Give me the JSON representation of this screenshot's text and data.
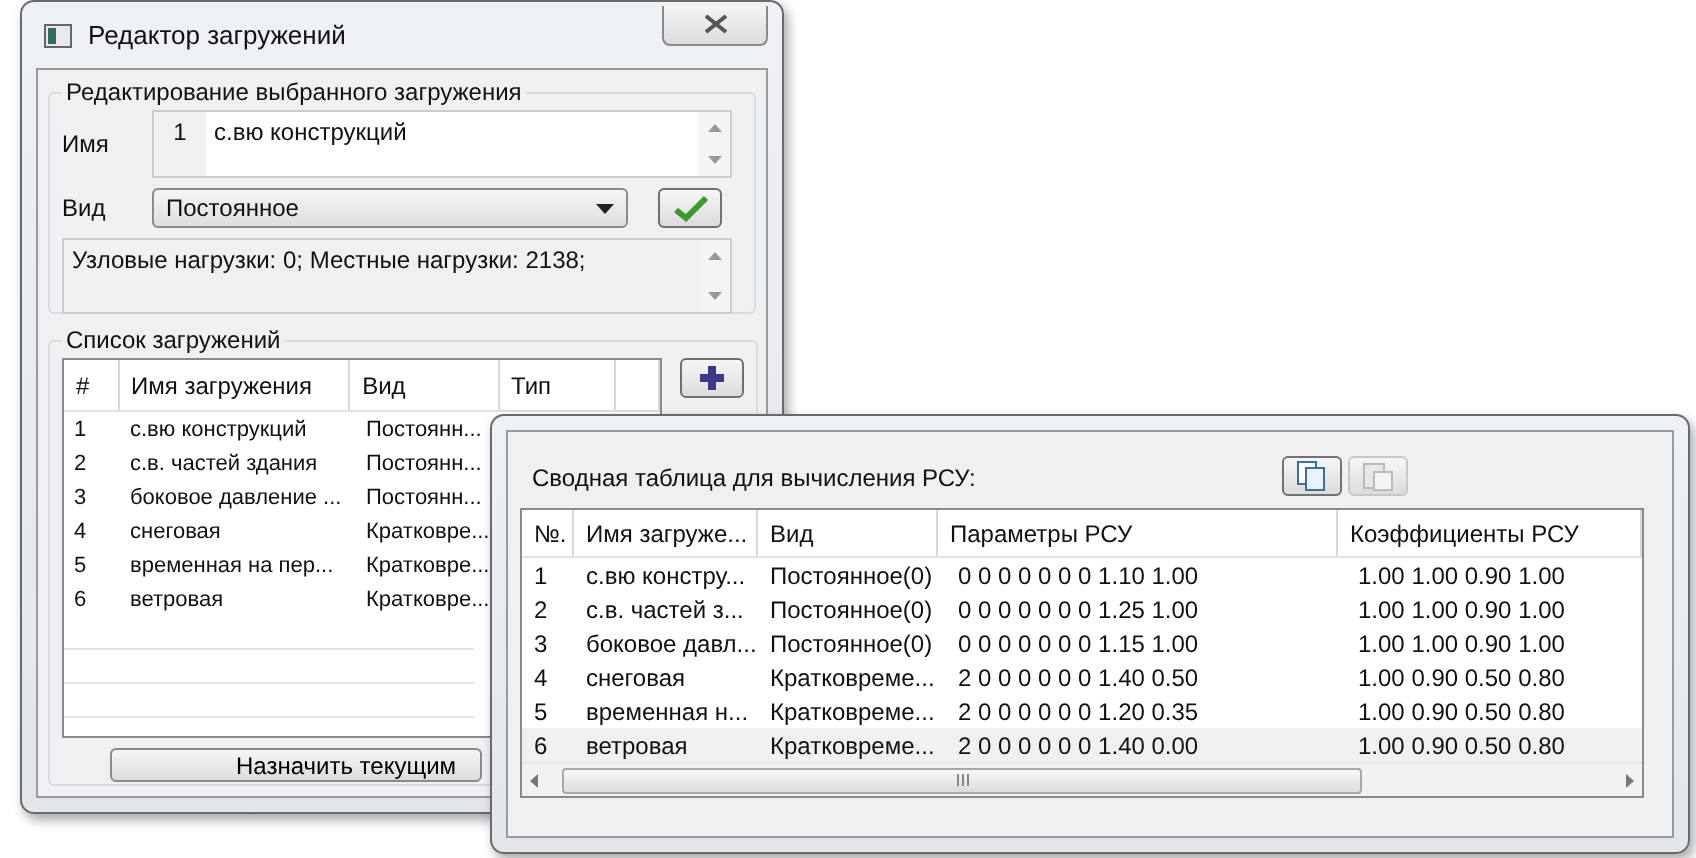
{
  "editor_window": {
    "title": "Редактор загружений",
    "edit_group": {
      "title": "Редактирование выбранного загружения",
      "name_label": "Имя",
      "number": "1",
      "name_value": "с.вю конструкций",
      "type_label": "Вид",
      "type_value": "Постоянное",
      "info": "Узловые нагрузки:  0;  Местные нагрузки:  2138;"
    },
    "list_group": {
      "title": "Список загружений",
      "columns": [
        "#",
        "Имя загружения",
        "Вид",
        "Тип"
      ],
      "rows": [
        {
          "cells": [
            "1",
            "с.вю конструкций",
            "Постоянн..."
          ]
        },
        {
          "cells": [
            "2",
            "с.в. частей здания",
            "Постоянн..."
          ]
        },
        {
          "cells": [
            "3",
            "боковое давление ...",
            "Постоянн..."
          ]
        },
        {
          "cells": [
            "4",
            "снеговая",
            "Кратковре..."
          ]
        },
        {
          "cells": [
            "5",
            "временная на пер...",
            "Кратковре..."
          ]
        },
        {
          "cells": [
            "6",
            "ветровая",
            "Кратковре..."
          ]
        }
      ],
      "assign_button": "Назначить текущим"
    }
  },
  "summary_window": {
    "label": "Сводная таблица для вычисления РСУ:",
    "toolbar": [
      {
        "kind": "copy",
        "disabled": false
      },
      {
        "kind": "paste",
        "disabled": true
      }
    ],
    "columns": [
      "№.",
      "Имя загруже...",
      "Вид",
      "Параметры РСУ",
      "Коэффициенты РСУ"
    ],
    "rows": [
      {
        "cells": [
          "1",
          "с.вю констру...",
          "Постоянное(0)",
          "0 0 0 0 0 0 0 1.10 1.00",
          "1.00 1.00 0.90 1.00"
        ],
        "selected": false
      },
      {
        "cells": [
          "2",
          "с.в. частей з...",
          "Постоянное(0)",
          "0 0 0 0 0 0 0 1.25 1.00",
          "1.00 1.00 0.90 1.00"
        ],
        "selected": false
      },
      {
        "cells": [
          "3",
          "боковое давл...",
          "Постоянное(0)",
          "0 0 0 0 0 0 0 1.15 1.00",
          "1.00 1.00 0.90 1.00"
        ],
        "selected": false
      },
      {
        "cells": [
          "4",
          "снеговая",
          "Кратковреме...",
          "2 0 0 0 0 0 0 1.40 0.50",
          "1.00 0.90 0.50 0.80"
        ],
        "selected": false
      },
      {
        "cells": [
          "5",
          "временная н...",
          "Кратковреме...",
          "2 0 0 0 0 0 0 1.20 0.35",
          "1.00 0.90 0.50 0.80"
        ],
        "selected": false
      },
      {
        "cells": [
          "6",
          "ветровая",
          "Кратковреме...",
          "2 0 0 0 0 0 0 1.40 0.00",
          "1.00 0.90 0.50 0.80"
        ],
        "selected": true
      }
    ]
  }
}
